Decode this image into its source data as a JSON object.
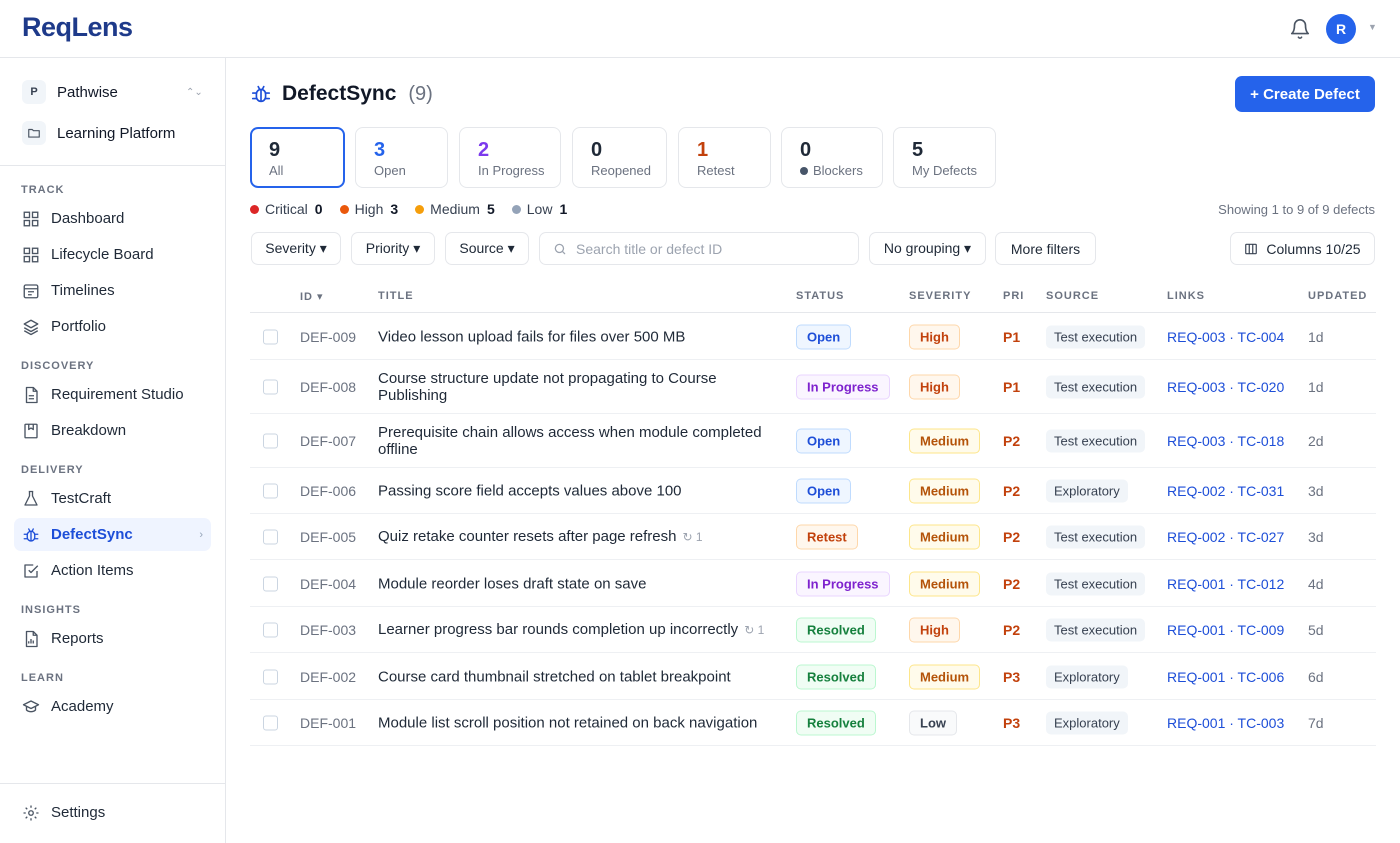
{
  "app": {
    "logo_prefix": "Req",
    "logo_suffix": "Lens",
    "avatar_initial": "R"
  },
  "workspace": {
    "badge": "P",
    "name": "Pathwise",
    "project": "Learning Platform"
  },
  "sidebar": {
    "sections": [
      {
        "title": "TRACK",
        "items": [
          {
            "label": "Dashboard",
            "icon": "grid-icon"
          },
          {
            "label": "Lifecycle Board",
            "icon": "grid-icon"
          },
          {
            "label": "Timelines",
            "icon": "calendar-icon"
          },
          {
            "label": "Portfolio",
            "icon": "layers-icon"
          }
        ]
      },
      {
        "title": "DISCOVERY",
        "items": [
          {
            "label": "Requirement Studio",
            "icon": "document-icon"
          },
          {
            "label": "Breakdown",
            "icon": "bookmark-icon"
          }
        ]
      },
      {
        "title": "DELIVERY",
        "items": [
          {
            "label": "TestCraft",
            "icon": "flask-icon"
          },
          {
            "label": "DefectSync",
            "icon": "bug-icon"
          },
          {
            "label": "Action Items",
            "icon": "checkbox-icon"
          }
        ]
      },
      {
        "title": "INSIGHTS",
        "items": [
          {
            "label": "Reports",
            "icon": "report-icon"
          }
        ]
      },
      {
        "title": "LEARN",
        "items": [
          {
            "label": "Academy",
            "icon": "graduation-cap-icon"
          }
        ]
      }
    ],
    "settings_label": "Settings"
  },
  "header": {
    "title": "DefectSync",
    "count": "(9)",
    "create_label": "+ Create Defect"
  },
  "tabs": [
    {
      "count": "9",
      "label": "All",
      "color": "#111827"
    },
    {
      "count": "3",
      "label": "Open",
      "color": "#2563eb"
    },
    {
      "count": "2",
      "label": "In Progress",
      "color": "#7c3aed"
    },
    {
      "count": "0",
      "label": "Reopened",
      "color": "#111827"
    },
    {
      "count": "1",
      "label": "Retest",
      "color": "#c2410c"
    },
    {
      "count": "0",
      "label": "Blockers",
      "color": "#111827"
    },
    {
      "count": "5",
      "label": "My Defects",
      "color": "#111827"
    }
  ],
  "severity_legend": [
    {
      "label": "Critical",
      "count": "0",
      "color": "#dc2626"
    },
    {
      "label": "High",
      "count": "3",
      "color": "#ea580c"
    },
    {
      "label": "Medium",
      "count": "5",
      "color": "#f59e0b"
    },
    {
      "label": "Low",
      "count": "1",
      "color": "#94a3b8"
    }
  ],
  "showing_text": "Showing 1 to 9 of 9 defects",
  "filters": {
    "severity": "Severity ▾",
    "priority": "Priority ▾",
    "source": "Source ▾",
    "search_placeholder": "Search title or defect ID",
    "grouping": "No grouping ▾",
    "more": "More filters",
    "columns": "Columns 10/25"
  },
  "table": {
    "headers": {
      "id": "ID ▾",
      "title": "TITLE",
      "status": "STATUS",
      "severity": "SEVERITY",
      "pri": "PRI",
      "source": "SOURCE",
      "links": "LINKS",
      "updated": "UPDATED"
    },
    "rows": [
      {
        "id": "DEF-009",
        "title": "Video lesson upload fails for files over 500 MB",
        "reopen": "",
        "status": "Open",
        "severity": "High",
        "pri": "P1",
        "source": "Test execution",
        "links": "REQ-003 · TC-004",
        "updated": "1d"
      },
      {
        "id": "DEF-008",
        "title": "Course structure update not propagating to Course Publishing",
        "reopen": "",
        "status": "In Progress",
        "severity": "High",
        "pri": "P1",
        "source": "Test execution",
        "links": "REQ-003 · TC-020",
        "updated": "1d"
      },
      {
        "id": "DEF-007",
        "title": "Prerequisite chain allows access when module completed offline",
        "reopen": "",
        "status": "Open",
        "severity": "Medium",
        "pri": "P2",
        "source": "Test execution",
        "links": "REQ-003 · TC-018",
        "updated": "2d"
      },
      {
        "id": "DEF-006",
        "title": "Passing score field accepts values above 100",
        "reopen": "",
        "status": "Open",
        "severity": "Medium",
        "pri": "P2",
        "source": "Exploratory",
        "links": "REQ-002 · TC-031",
        "updated": "3d"
      },
      {
        "id": "DEF-005",
        "title": "Quiz retake counter resets after page refresh",
        "reopen": "↻ 1",
        "status": "Retest",
        "severity": "Medium",
        "pri": "P2",
        "source": "Test execution",
        "links": "REQ-002 · TC-027",
        "updated": "3d"
      },
      {
        "id": "DEF-004",
        "title": "Module reorder loses draft state on save",
        "reopen": "",
        "status": "In Progress",
        "severity": "Medium",
        "pri": "P2",
        "source": "Test execution",
        "links": "REQ-001 · TC-012",
        "updated": "4d"
      },
      {
        "id": "DEF-003",
        "title": "Learner progress bar rounds completion up incorrectly",
        "reopen": "↻ 1",
        "status": "Resolved",
        "severity": "High",
        "pri": "P2",
        "source": "Test execution",
        "links": "REQ-001 · TC-009",
        "updated": "5d"
      },
      {
        "id": "DEF-002",
        "title": "Course card thumbnail stretched on tablet breakpoint",
        "reopen": "",
        "status": "Resolved",
        "severity": "Medium",
        "pri": "P3",
        "source": "Exploratory",
        "links": "REQ-001 · TC-006",
        "updated": "6d"
      },
      {
        "id": "DEF-001",
        "title": "Module list scroll position not retained on back navigation",
        "reopen": "",
        "status": "Resolved",
        "severity": "Low",
        "pri": "P3",
        "source": "Exploratory",
        "links": "REQ-001 · TC-003",
        "updated": "7d"
      }
    ]
  },
  "status_styles": {
    "Open": {
      "color": "#1d4ed8",
      "bg": "#eff6ff",
      "border": "#bfdbfe"
    },
    "In Progress": {
      "color": "#7e22ce",
      "bg": "#faf5ff",
      "border": "#e9d5ff"
    },
    "Retest": {
      "color": "#c2410c",
      "bg": "#fff7ed",
      "border": "#fed7aa"
    },
    "Resolved": {
      "color": "#15803d",
      "bg": "#f0fdf4",
      "border": "#bbf7d0"
    }
  },
  "severity_styles": {
    "High": {
      "color": "#c2410c",
      "bg": "#fff7ed",
      "border": "#fed7aa"
    },
    "Medium": {
      "color": "#b45309",
      "bg": "#fffbeb",
      "border": "#fde68a"
    },
    "Low": {
      "color": "#374151",
      "bg": "#f9fafb",
      "border": "#e5e7eb"
    }
  }
}
